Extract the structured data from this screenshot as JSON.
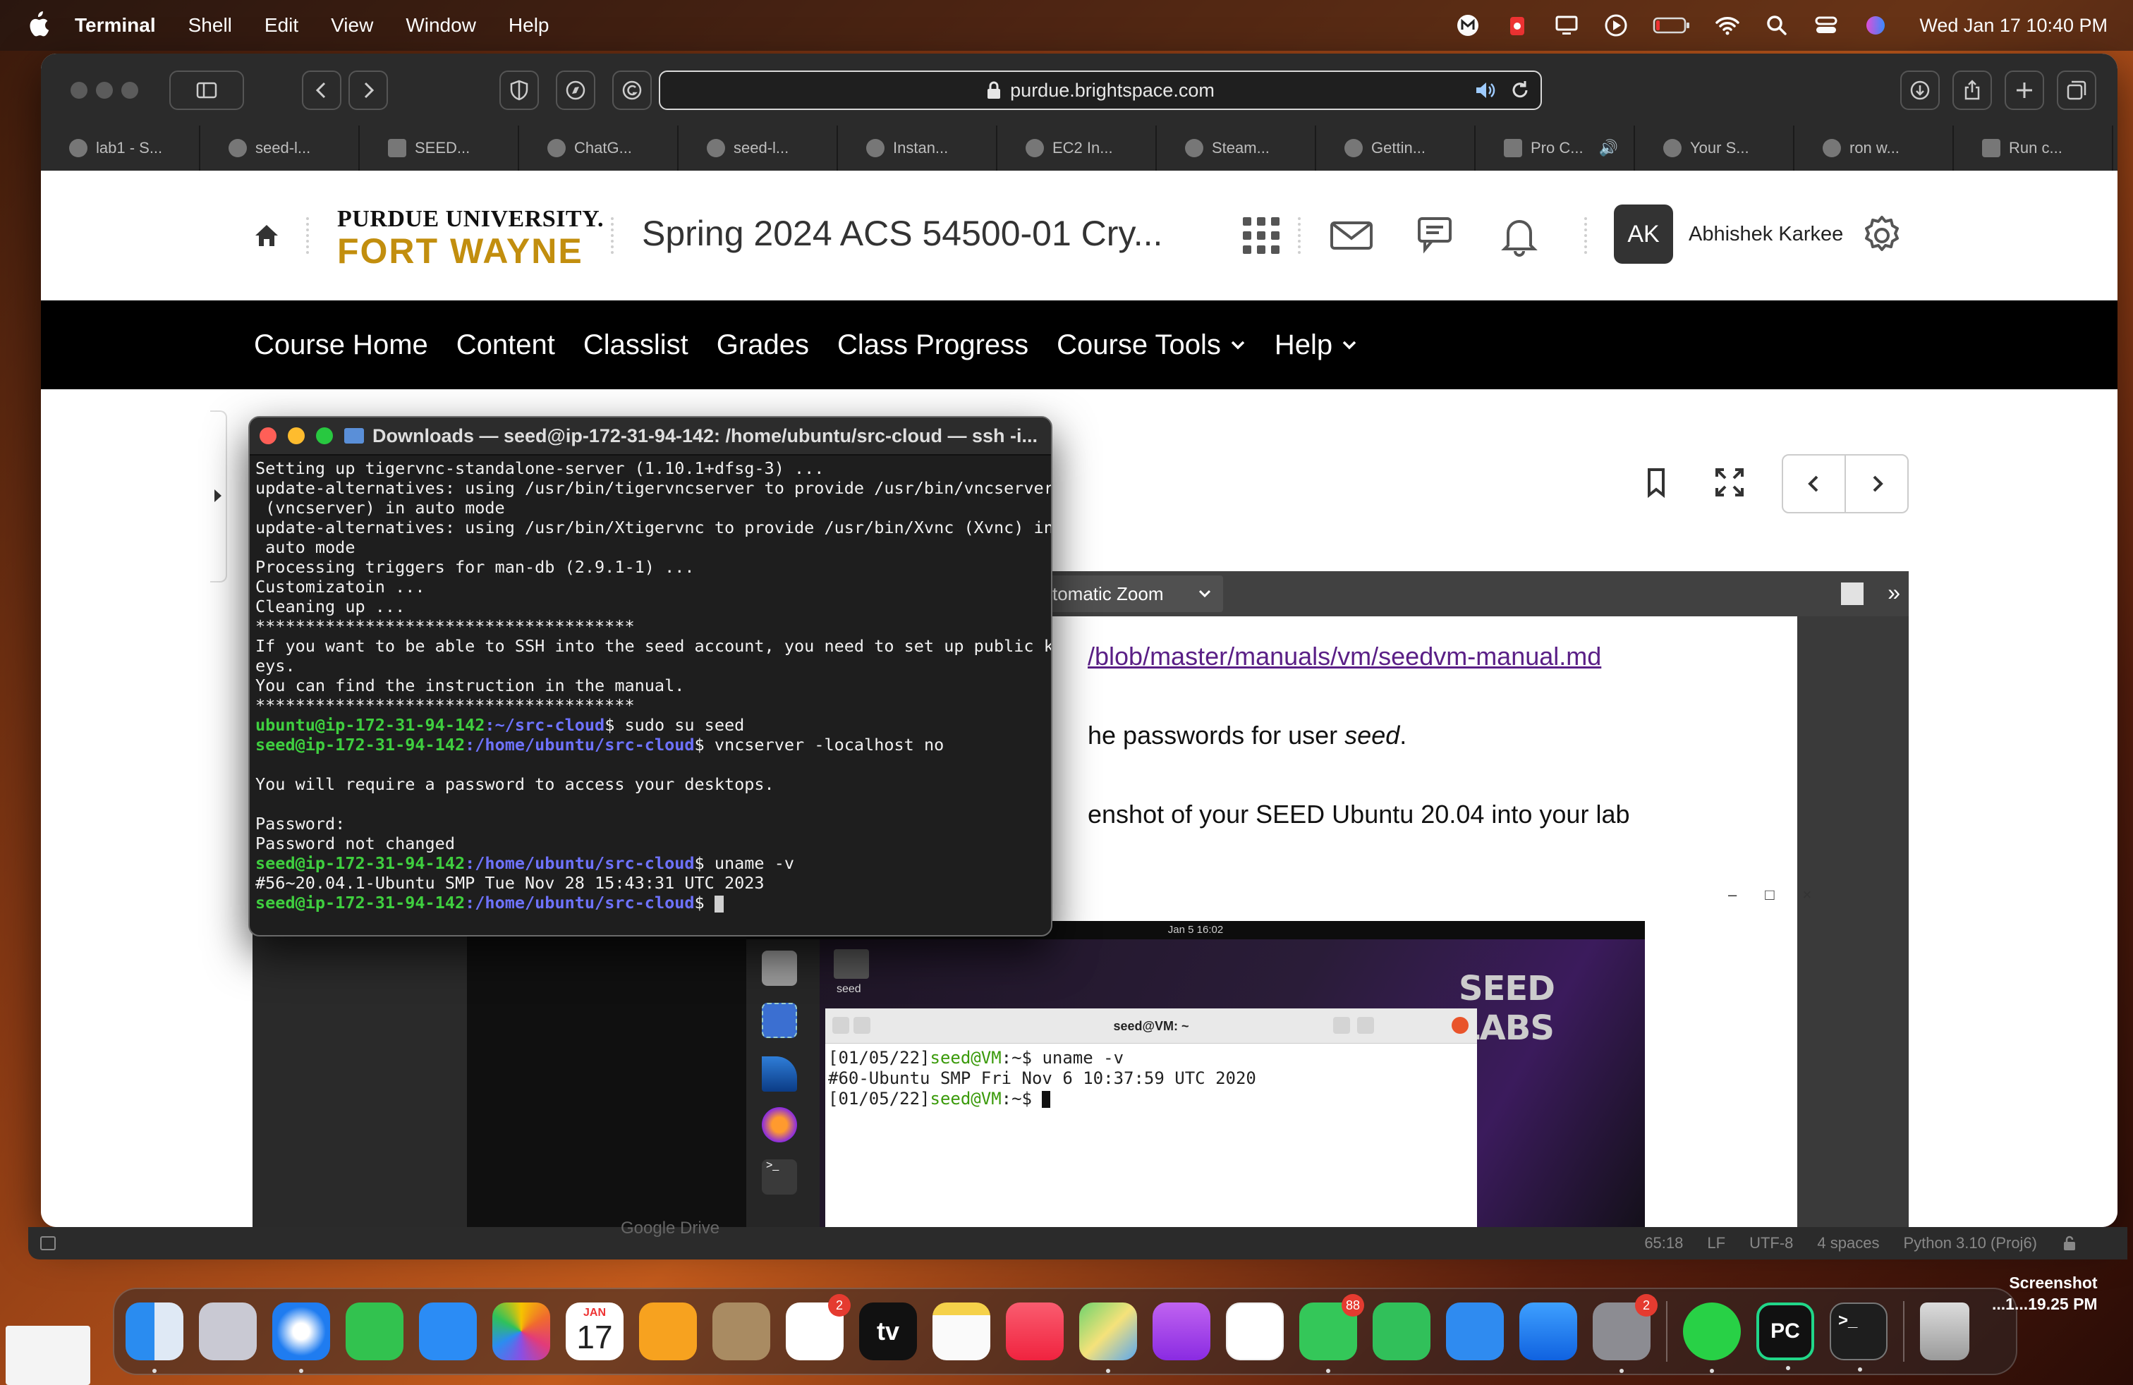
{
  "menubar": {
    "app_name": "Terminal",
    "menus": [
      "Shell",
      "Edit",
      "View",
      "Window",
      "Help"
    ],
    "clock": "Wed Jan 17  10:40 PM"
  },
  "browser": {
    "url": "purdue.brightspace.com",
    "tabs": [
      "lab1 - S...",
      "seed-l...",
      "SEED...",
      "ChatG...",
      "seed-l...",
      "Instan...",
      "EC2 In...",
      "Steam...",
      "Gettin...",
      "Pro C...",
      "Your S...",
      "ron w...",
      "Run c..."
    ]
  },
  "site": {
    "logo_line1": "PURDUE UNIVERSITY.",
    "logo_line2": "FORT WAYNE",
    "course_title": "Spring 2024 ACS 54500-01 Cry...",
    "user_initials": "AK",
    "user_name": "Abhishek Karkee",
    "nav": [
      "Course Home",
      "Content",
      "Classlist",
      "Grades",
      "Class Progress",
      "Course Tools",
      "Help"
    ]
  },
  "pdf": {
    "zoom_label": "tomatic Zoom",
    "line1_link": "/blob/master/manuals/vm/seedvm-manual.md",
    "line2_prefix": "he passwords for user ",
    "line2_em": "seed",
    "line2_suffix": ".",
    "line3": "enshot of your SEED Ubuntu 20.04 into your lab"
  },
  "vm": {
    "topbar": "Jan 5  16:02",
    "term_title": "seed@VM: ~",
    "folder_label": "seed",
    "line1_prefix": "[01/05/22]",
    "line1_user": "seed@VM",
    "line1_cmd": ":~$ uname -v",
    "line2": "#60-Ubuntu SMP Fri Nov 6 10:37:59 UTC 2020",
    "line3_prefix": "[01/05/22]",
    "line3_user": "seed@VM",
    "line3_cmd": ":~$ ",
    "logo": "SEED LABS"
  },
  "terminal": {
    "title": "Downloads — seed@ip-172-31-94-142: /home/ubuntu/src-cloud — ssh -i...",
    "lines": {
      "l1": "Setting up tigervnc-standalone-server (1.10.1+dfsg-3) ...",
      "l2": "update-alternatives: using /usr/bin/tigervncserver to provide /usr/bin/vncserver",
      "l3": " (vncserver) in auto mode",
      "l4": "update-alternatives: using /usr/bin/Xtigervnc to provide /usr/bin/Xvnc (Xvnc) in",
      "l5": " auto mode",
      "l6": "Processing triggers for man-db (2.9.1-1) ...",
      "l7": "Customizatoin ...",
      "l8": "Cleaning up ...",
      "l9": "**************************************",
      "l10": "If you want to be able to SSH into the seed account, you need to set up public k",
      "l11": "eys.",
      "l12": "You can find the instruction in the manual.",
      "l13": "**************************************",
      "p1_user": "ubuntu@ip-172-31-94-142",
      "p1_path": ":~/src-cloud",
      "p1_cmd": "$ sudo su seed",
      "p2_user": "seed@ip-172-31-94-142",
      "p2_path": ":/home/ubuntu/src-cloud",
      "p2_cmd": "$ vncserver -localhost no",
      "l14": "You will require a password to access your desktops.",
      "l15": "Password:",
      "l16": "Password not changed",
      "p3_user": "seed@ip-172-31-94-142",
      "p3_path": ":/home/ubuntu/src-cloud",
      "p3_cmd": "$ uname -v",
      "l17": "#56~20.04.1-Ubuntu SMP Tue Nov 28 15:43:31 UTC 2023",
      "p4_user": "seed@ip-172-31-94-142",
      "p4_path": ":/home/ubuntu/src-cloud",
      "p4_cmd": "$ "
    }
  },
  "backwindow": {
    "ghost_text": "Google Drive",
    "status_items": [
      "65:18",
      "LF",
      "UTF-8",
      "4 spaces",
      "Python 3.10 (Proj6)"
    ]
  },
  "dock": {
    "calendar_month": "JAN",
    "calendar_day": "17",
    "reminders_badge": "2",
    "messages_badge": "88",
    "settings_badge": "2",
    "tv_label": "tv",
    "pycharm_label": "PC"
  },
  "screenshot_label": {
    "line1": "Screenshot",
    "line2": "...1...19.25 PM"
  },
  "colors": {
    "brand_gold": "#c28e0e",
    "link_purple": "#5a1f86",
    "prompt_green": "#3fcf3f",
    "prompt_blue": "#6e72ff"
  }
}
